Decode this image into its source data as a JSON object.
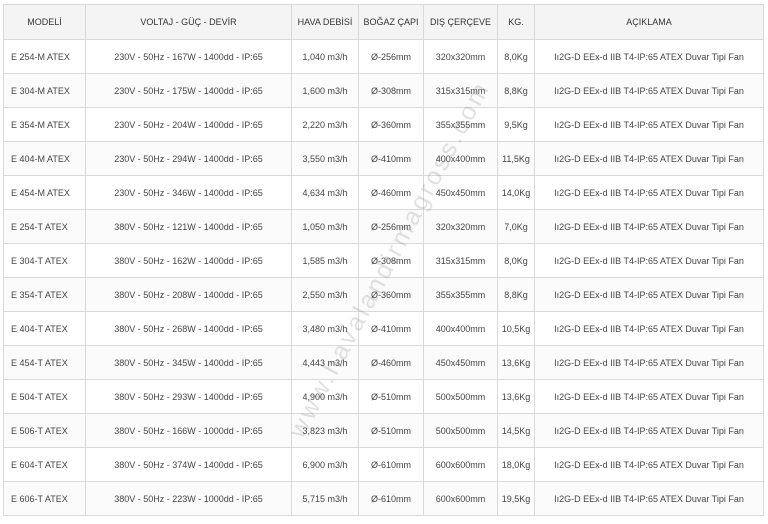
{
  "table": {
    "headers": [
      "MODELİ",
      "VOLTAJ - GÜÇ - DEVİR",
      "HAVA DEBİSİ",
      "BOĞAZ ÇAPI",
      "DIŞ ÇERÇEVE",
      "KG.",
      "AÇIKLAMA"
    ],
    "rows": [
      [
        "E 254-M ATEX",
        "230V - 50Hz - 167W - 1400dd - IP:65",
        "1,040 m3/h",
        "Ø-256mm",
        "320x320mm",
        "8,0Kg",
        "Iı2G-D EEx-d IIB T4-IP:65 ATEX Duvar Tipi Fan"
      ],
      [
        "E 304-M ATEX",
        "230V - 50Hz - 175W - 1400dd - IP:65",
        "1,600 m3/h",
        "Ø-308mm",
        "315x315mm",
        "8,8Kg",
        "Iı2G-D EEx-d IIB T4-IP:65 ATEX Duvar Tipi Fan"
      ],
      [
        "E 354-M ATEX",
        "230V - 50Hz - 204W - 1400dd - IP:65",
        "2,220 m3/h",
        "Ø-360mm",
        "355x355mm",
        "9,5Kg",
        "Iı2G-D EEx-d IIB T4-IP:65 ATEX Duvar Tipi Fan"
      ],
      [
        "E 404-M ATEX",
        "230V - 50Hz - 294W - 1400dd - IP:65",
        "3,550 m3/h",
        "Ø-410mm",
        "400x400mm",
        "11,5Kg",
        "Iı2G-D EEx-d IIB T4-IP:65 ATEX Duvar Tipi Fan"
      ],
      [
        "E 454-M ATEX",
        "230V - 50Hz - 346W - 1400dd - IP:65",
        "4,634 m3/h",
        "Ø-460mm",
        "450x450mm",
        "14,0Kg",
        "Iı2G-D EEx-d IIB T4-IP:65 ATEX Duvar Tipi Fan"
      ],
      [
        "E 254-T ATEX",
        "380V - 50Hz - 121W - 1400dd - IP:65",
        "1,050 m3/h",
        "Ø-256mm",
        "320x320mm",
        "7,0Kg",
        "Iı2G-D EEx-d IIB T4-IP:65 ATEX Duvar Tipi Fan"
      ],
      [
        "E 304-T ATEX",
        "380V - 50Hz - 162W - 1400dd - IP:65",
        "1,585 m3/h",
        "Ø-308mm",
        "315x315mm",
        "8,0Kg",
        "Iı2G-D EEx-d IIB T4-IP:65 ATEX Duvar Tipi Fan"
      ],
      [
        "E 354-T ATEX",
        "380V - 50Hz - 208W - 1400dd - IP:65",
        "2,550 m3/h",
        "Ø-360mm",
        "355x355mm",
        "8,8Kg",
        "Iı2G-D EEx-d IIB T4-IP:65 ATEX Duvar Tipi Fan"
      ],
      [
        "E 404-T ATEX",
        "380V - 50Hz - 268W - 1400dd - IP:65",
        "3,480 m3/h",
        "Ø-410mm",
        "400x400mm",
        "10,5Kg",
        "Iı2G-D EEx-d IIB T4-IP:65 ATEX Duvar Tipi Fan"
      ],
      [
        "E 454-T ATEX",
        "380V - 50Hz - 345W - 1400dd - IP:65",
        "4,443 m3/h",
        "Ø-460mm",
        "450x450mm",
        "13,6Kg",
        "Iı2G-D EEx-d IIB T4-IP:65 ATEX Duvar Tipi Fan"
      ],
      [
        "E 504-T ATEX",
        "380V - 50Hz - 293W - 1400dd - IP:65",
        "4,900 m3/h",
        "Ø-510mm",
        "500x500mm",
        "13,6Kg",
        "Iı2G-D EEx-d IIB T4-IP:65 ATEX Duvar Tipi Fan"
      ],
      [
        "E 506-T ATEX",
        "380V - 50Hz - 166W - 1000dd - IP:65",
        "3,823 m3/h",
        "Ø-510mm",
        "500x500mm",
        "14,5Kg",
        "Iı2G-D EEx-d IIB T4-IP:65 ATEX Duvar Tipi Fan"
      ],
      [
        "E 604-T ATEX",
        "380V - 50Hz - 374W - 1400dd - IP:65",
        "6,900 m3/h",
        "Ø-610mm",
        "600x600mm",
        "18,0Kg",
        "Iı2G-D EEx-d IIB T4-IP:65 ATEX Duvar Tipi Fan"
      ],
      [
        "E 606-T ATEX",
        "380V - 50Hz - 223W - 1000dd - IP:65",
        "5,715 m3/h",
        "Ø-610mm",
        "600x600mm",
        "19,5Kg",
        "Iı2G-D EEx-d IIB T4-IP:65 ATEX Duvar Tipi Fan"
      ]
    ]
  },
  "watermark": "www.havalandirmagross.com"
}
